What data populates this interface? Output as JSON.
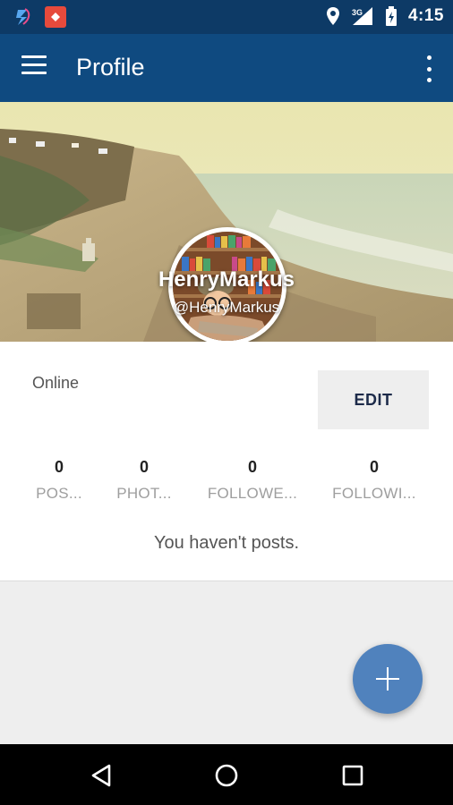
{
  "status_bar": {
    "time": "4:15",
    "network": "3G",
    "icons": [
      "app-notification-icon",
      "app-notification-icon-2",
      "location-icon",
      "signal-icon",
      "battery-icon"
    ]
  },
  "app_bar": {
    "title": "Profile",
    "menu_icon": "hamburger-menu-icon",
    "overflow_icon": "more-vert-icon",
    "color": "#0f4a80"
  },
  "profile": {
    "name": "HenryMarkus",
    "handle": "@HenryMarkus",
    "status": "Online",
    "edit_label": "EDIT"
  },
  "stats": [
    {
      "value": "0",
      "label": "POS..."
    },
    {
      "value": "0",
      "label": "PHOT..."
    },
    {
      "value": "0",
      "label": "FOLLOWE..."
    },
    {
      "value": "0",
      "label": "FOLLOWI..."
    }
  ],
  "empty_message": "You haven't posts.",
  "fab": {
    "icon": "plus-icon",
    "color": "#5082bd"
  },
  "nav_bar": {
    "icons": [
      "back-icon",
      "home-icon",
      "recents-icon"
    ]
  }
}
